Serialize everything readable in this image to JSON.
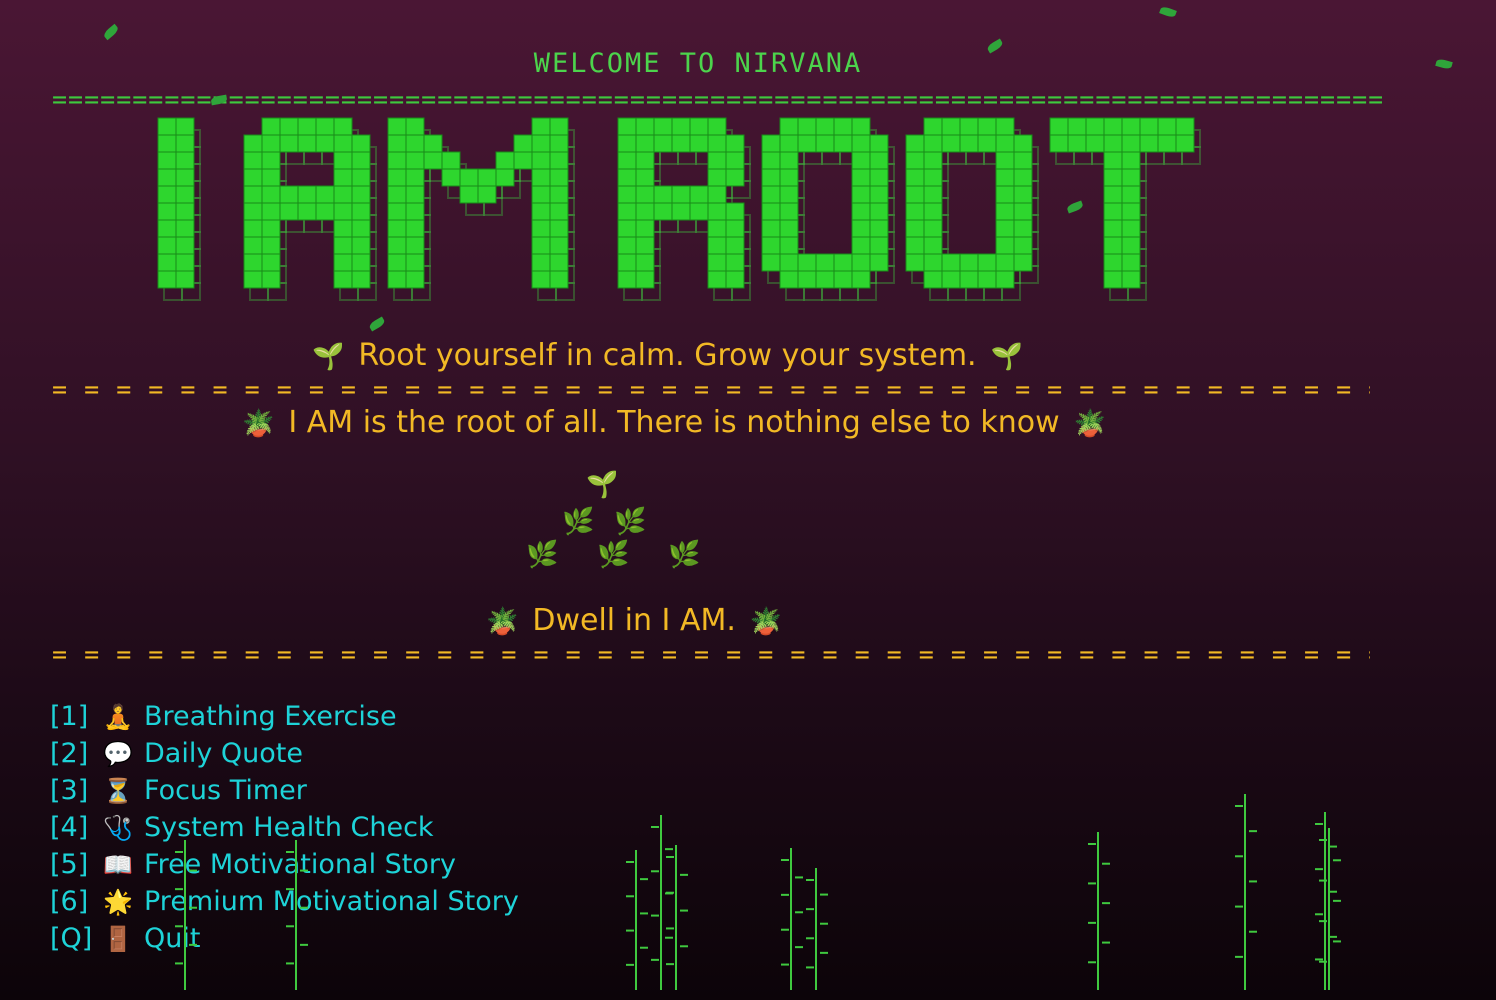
{
  "header": {
    "welcome": "WELCOME TO NIRVANA",
    "rule": "========================================================================================================"
  },
  "banner": {
    "text": "I AM ROOT"
  },
  "taglines": [
    {
      "emoji_left": "🌱",
      "text": "Root yourself in calm. Grow your system.",
      "emoji_right": "🌱"
    },
    {
      "emoji_left": "🪴",
      "text": "I AM is the root of all. There is nothing else to know",
      "emoji_right": "🪴"
    },
    {
      "emoji_left": "🪴",
      "text": "Dwell in I AM.",
      "emoji_right": "🪴"
    }
  ],
  "dashed_rule": "= = = = = = = = = = = = = = = = = = = = = = = = = = = = = = = = = = = = = = = = = = = = = = = = = = = = = = = = = = = = = = = = = = = = = = = = = = = =",
  "plant": {
    "top": "🌱",
    "mid": [
      "🌿",
      "🌿"
    ],
    "bottom": [
      "🌿",
      "🌿",
      "🌿"
    ]
  },
  "menu": [
    {
      "key": "[1]",
      "icon": "🧘",
      "label": "Breathing Exercise"
    },
    {
      "key": "[2]",
      "icon": "💬",
      "label": "Daily Quote"
    },
    {
      "key": "[3]",
      "icon": "⏳",
      "label": "Focus Timer"
    },
    {
      "key": "[4]",
      "icon": "🩺",
      "label": "System Health Check"
    },
    {
      "key": "[5]",
      "icon": "📖",
      "label": "Free Motivational Story"
    },
    {
      "key": "[6]",
      "icon": "🌟",
      "label": "Premium Motivational Story"
    },
    {
      "key": "[Q]",
      "icon": "🚪",
      "label": "Quit"
    }
  ],
  "colors": {
    "green": "#3ec93e",
    "yellow": "#f2b925",
    "cyan": "#1ed3d8"
  }
}
